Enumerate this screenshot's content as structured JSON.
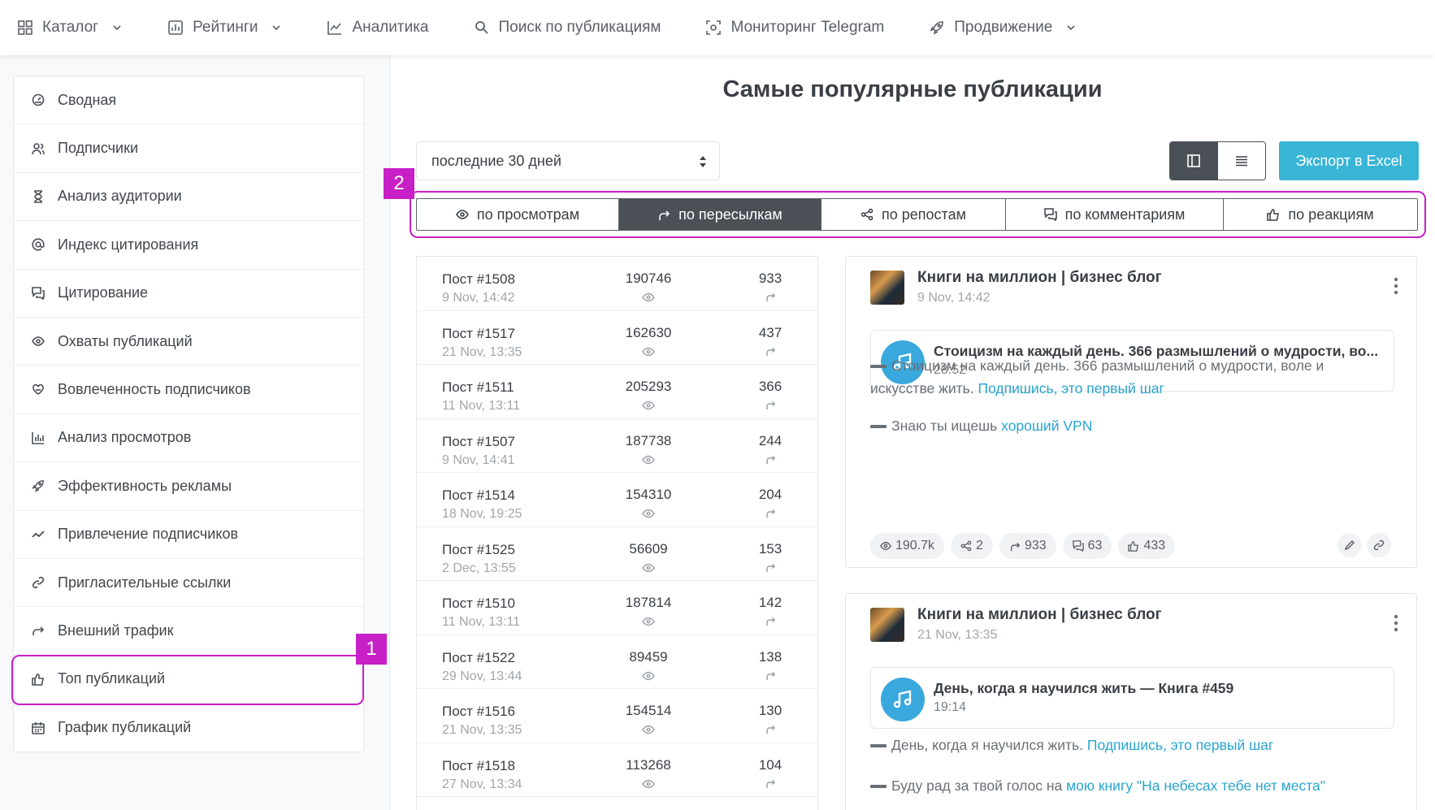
{
  "topnav": {
    "items": [
      {
        "label": "Каталог",
        "icon": "grid-icon"
      },
      {
        "label": "Рейтинги",
        "icon": "rating-chart-icon"
      },
      {
        "label": "Аналитика",
        "icon": "line-chart-icon"
      },
      {
        "label": "Поиск по публикациям",
        "icon": "search-icon"
      },
      {
        "label": "Мониторинг Telegram",
        "icon": "monitor-scan-icon"
      },
      {
        "label": "Продвижение",
        "icon": "rocket-icon"
      }
    ]
  },
  "sidebar": {
    "items": [
      {
        "label": "Сводная",
        "icon": "dashboard-icon"
      },
      {
        "label": "Подписчики",
        "icon": "users-icon"
      },
      {
        "label": "Анализ аудитории",
        "icon": "hourglass-icon"
      },
      {
        "label": "Индекс цитирования",
        "icon": "at-sign-icon"
      },
      {
        "label": "Цитирование",
        "icon": "quote-comments-icon"
      },
      {
        "label": "Охваты публикаций",
        "icon": "eye-icon"
      },
      {
        "label": "Вовлеченность подписчиков",
        "icon": "heart-hand-icon"
      },
      {
        "label": "Анализ просмотров",
        "icon": "bar-chart-icon"
      },
      {
        "label": "Эффективность рекламы",
        "icon": "rocket-icon"
      },
      {
        "label": "Привлечение подписчиков",
        "icon": "trend-icon"
      },
      {
        "label": "Пригласительные ссылки",
        "icon": "link-icon"
      },
      {
        "label": "Внешний трафик",
        "icon": "forward-arrow-icon"
      },
      {
        "label": "Топ публикаций",
        "icon": "thumbs-up-icon"
      },
      {
        "label": "График публикаций",
        "icon": "calendar-icon"
      }
    ]
  },
  "main": {
    "title": "Самые популярные публикации",
    "period": "последние 30 дней",
    "export_label": "Экспорт в Excel",
    "tabs": [
      {
        "label": "по просмотрам",
        "icon": "eye-icon",
        "active": false
      },
      {
        "label": "по пересылкам",
        "icon": "forward-arrow-icon",
        "active": true
      },
      {
        "label": "по репостам",
        "icon": "share-icon",
        "active": false
      },
      {
        "label": "по комментариям",
        "icon": "comments-icon",
        "active": false
      },
      {
        "label": "по реакциям",
        "icon": "thumbs-up-icon",
        "active": false
      }
    ]
  },
  "annotations": {
    "badge1": "1",
    "badge2": "2",
    "color": "#c620c6"
  },
  "posts": [
    {
      "title": "Пост #1508",
      "date": "9 Nov, 14:42",
      "views": "190746",
      "forwards": "933"
    },
    {
      "title": "Пост #1517",
      "date": "21 Nov, 13:35",
      "views": "162630",
      "forwards": "437"
    },
    {
      "title": "Пост #1511",
      "date": "11 Nov, 13:11",
      "views": "205293",
      "forwards": "366"
    },
    {
      "title": "Пост #1507",
      "date": "9 Nov, 14:41",
      "views": "187738",
      "forwards": "244"
    },
    {
      "title": "Пост #1514",
      "date": "18 Nov, 19:25",
      "views": "154310",
      "forwards": "204"
    },
    {
      "title": "Пост #1525",
      "date": "2 Dec, 13:55",
      "views": "56609",
      "forwards": "153"
    },
    {
      "title": "Пост #1510",
      "date": "11 Nov, 13:11",
      "views": "187814",
      "forwards": "142"
    },
    {
      "title": "Пост #1522",
      "date": "29 Nov, 13:44",
      "views": "89459",
      "forwards": "138"
    },
    {
      "title": "Пост #1516",
      "date": "21 Nov, 13:35",
      "views": "154514",
      "forwards": "130"
    },
    {
      "title": "Пост #1518",
      "date": "27 Nov, 13:34",
      "views": "113268",
      "forwards": "104"
    }
  ],
  "cards": [
    {
      "channel": "Книги на миллион | бизнес блог",
      "date": "9 Nov, 14:42",
      "audio_title": "Стоицизм на каждый день. 366 размышлений о мудрости, во...",
      "audio_duration": "28:52",
      "p1_text": "Стоицизм на каждый день. 366 размышлений о мудрости, воле и искусстве жить. ",
      "p1_link": "Подпишись, это первый шаг",
      "p2_text": "Знаю ты ищешь ",
      "p2_link": "хороший VPN",
      "stats": {
        "views": "190.7k",
        "reposts": "2",
        "forwards": "933",
        "comments": "63",
        "reactions": "433"
      }
    },
    {
      "channel": "Книги на миллион | бизнес блог",
      "date": "21 Nov, 13:35",
      "audio_title": "День, когда я научился жить — Книга #459",
      "audio_duration": "19:14",
      "p1_text": "День, когда я научился жить. ",
      "p1_link": "Подпишись, это первый шаг",
      "p2_text": "Буду рад за твой голос на ",
      "p2_link": "мою книгу \"На небесах тебе нет места\""
    }
  ]
}
